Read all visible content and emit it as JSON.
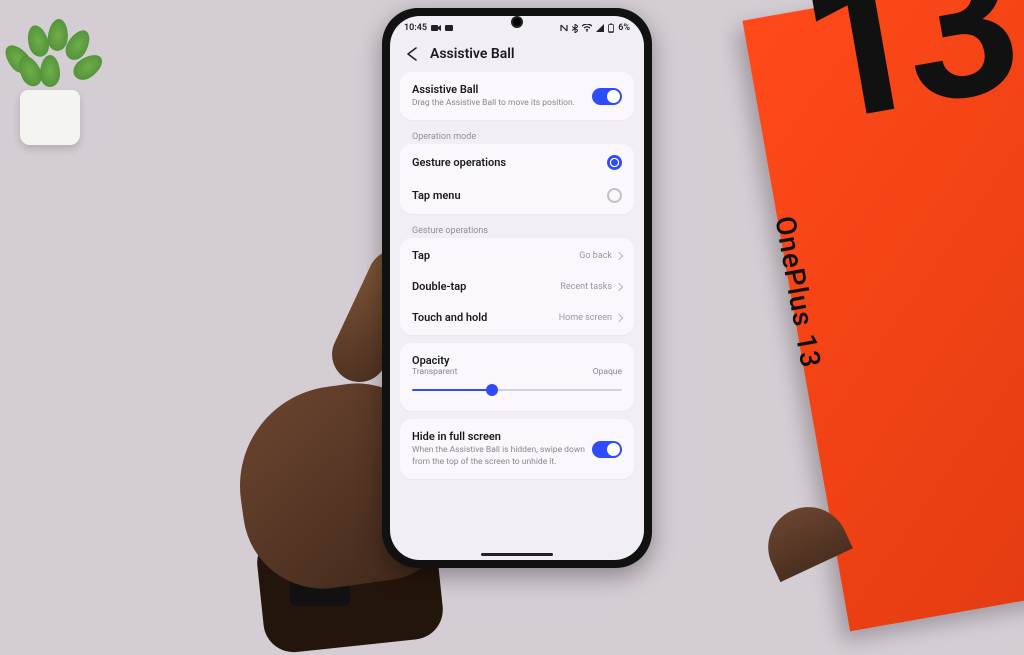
{
  "status": {
    "time": "10:45",
    "battery": "6%"
  },
  "header": {
    "title": "Assistive Ball"
  },
  "main_toggle": {
    "title": "Assistive Ball",
    "subtitle": "Drag the Assistive Ball to move its position.",
    "enabled": true
  },
  "operation_mode": {
    "label": "Operation mode",
    "options": [
      {
        "label": "Gesture operations",
        "selected": true
      },
      {
        "label": "Tap menu",
        "selected": false
      }
    ]
  },
  "gesture_ops": {
    "label": "Gesture operations",
    "items": [
      {
        "label": "Tap",
        "value": "Go back"
      },
      {
        "label": "Double-tap",
        "value": "Recent tasks"
      },
      {
        "label": "Touch and hold",
        "value": "Home screen"
      }
    ]
  },
  "opacity": {
    "title": "Opacity",
    "left_label": "Transparent",
    "right_label": "Opaque",
    "percent": 38
  },
  "hide": {
    "title": "Hide in full screen",
    "subtitle": "When the Assistive Ball is hidden, swipe down from the top of the screen to unhide it.",
    "enabled": true
  },
  "scene": {
    "box_brand": "OnePlus 13"
  }
}
